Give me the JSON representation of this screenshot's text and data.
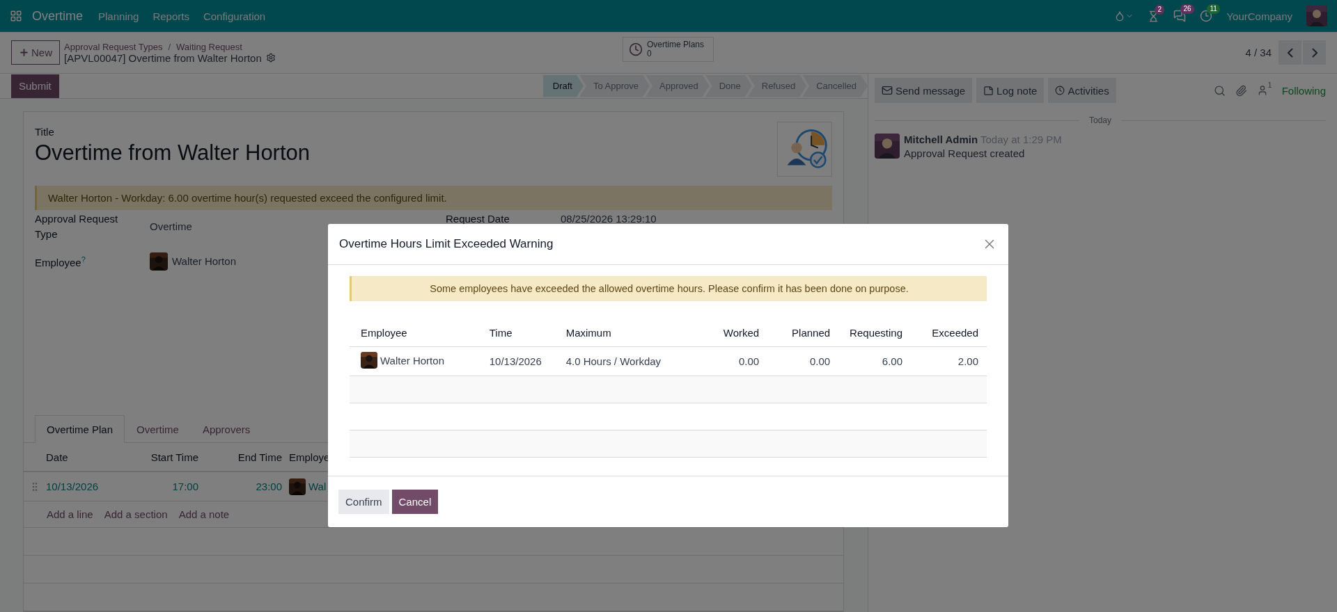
{
  "navbar": {
    "app_name": "Overtime",
    "menus": [
      "Planning",
      "Reports",
      "Configuration"
    ],
    "systray": [
      {
        "kind": "hourglass",
        "count": "2",
        "color": "#62305c"
      },
      {
        "kind": "chat",
        "count": "26",
        "color": "#62305c"
      },
      {
        "kind": "clock",
        "count": "11",
        "color": "#1c6432"
      }
    ],
    "company": "YourCompany"
  },
  "control_panel": {
    "new_button": "New",
    "breadcrumbs": [
      "Approval Request Types",
      "Waiting Request"
    ],
    "breadcrumb_separator": "/",
    "record_title": "[APVL00047] Overtime from Walter Horton",
    "stat_button": {
      "label": "Overtime Plans",
      "value": "0"
    },
    "pager": "4 / 34"
  },
  "status_bar": {
    "submit": "Submit",
    "stages": [
      {
        "label": "Draft",
        "selected": true
      },
      {
        "label": "To Approve",
        "selected": false
      },
      {
        "label": "Approved",
        "selected": false
      },
      {
        "label": "Done",
        "selected": false
      },
      {
        "label": "Refused",
        "selected": false
      },
      {
        "label": "Cancelled",
        "selected": false
      }
    ]
  },
  "form": {
    "title_label": "Title",
    "title": "Overtime from Walter Horton",
    "alert": "Walter Horton - Workday: 6.00 overtime hour(s) requested exceed the configured limit.",
    "left_fields": [
      {
        "label": "Approval Request Type",
        "value": "Overtime",
        "kind": "text"
      },
      {
        "label": "Employee",
        "help": "?",
        "value": "Walter Horton",
        "kind": "employee"
      }
    ],
    "right_fields": [
      {
        "label": "Request Date",
        "value": "08/25/2026 13:29:10",
        "kind": "text"
      }
    ],
    "tabs": [
      {
        "label": "Overtime Plan",
        "selected": true
      },
      {
        "label": "Overtime",
        "selected": false
      },
      {
        "label": "Approvers",
        "selected": false
      }
    ],
    "plan_list": {
      "columns": [
        "Date",
        "Start Time",
        "End Time",
        "Employe"
      ],
      "rows": [
        {
          "date": "10/13/2026",
          "start_time": "17:00",
          "end_time": "23:00",
          "employee": "Wal"
        }
      ],
      "add_links": [
        "Add a line",
        "Add a section",
        "Add a note"
      ]
    }
  },
  "chatter": {
    "buttons": [
      {
        "kind": "message",
        "label": "Send message"
      },
      {
        "kind": "note",
        "label": "Log note"
      },
      {
        "kind": "activity",
        "label": "Activities"
      }
    ],
    "follower_count": "1",
    "follow_label": "Following",
    "day": "Today",
    "messages": [
      {
        "author": "Mitchell Admin",
        "time": "Today at 1:29 PM",
        "body": "Approval Request created"
      }
    ]
  },
  "dialog": {
    "title": "Overtime Hours Limit Exceeded Warning",
    "alert": "Some employees have exceeded the allowed overtime hours. Please confirm it has been done on purpose.",
    "columns": [
      "Employee",
      "Time",
      "Maximum",
      "Worked",
      "Planned",
      "Requesting",
      "Exceeded"
    ],
    "rows": [
      {
        "employee": "Walter Horton",
        "time": "10/13/2026",
        "maximum": "4.0 Hours / Workday",
        "worked": "0.00",
        "planned": "0.00",
        "requesting": "6.00",
        "exceeded": "2.00"
      }
    ],
    "buttons": [
      {
        "kind": "secondary",
        "label": "Confirm"
      },
      {
        "kind": "primary",
        "label": "Cancel"
      }
    ]
  }
}
